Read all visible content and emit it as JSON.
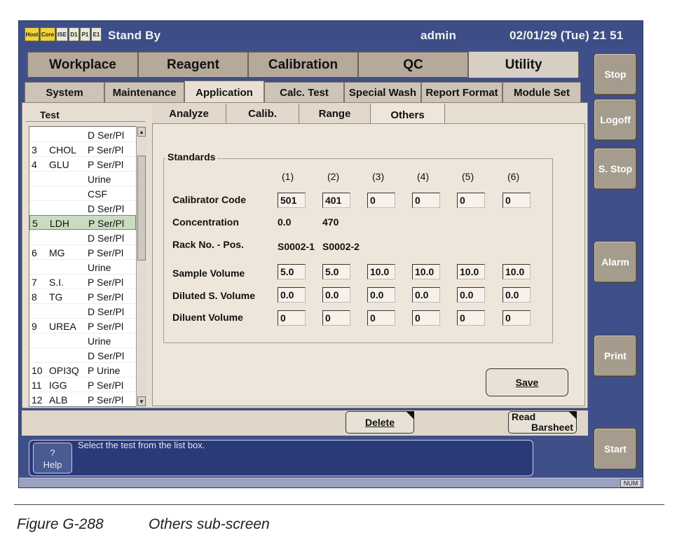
{
  "title_bar": {
    "indicators": [
      "Host",
      "Core",
      "ISE",
      "D1",
      "P1",
      "E1"
    ],
    "status": "Stand By",
    "user": "admin",
    "datetime": "02/01/29 (Tue) 21 51"
  },
  "main_tabs": [
    "Workplace",
    "Reagent",
    "Calibration",
    "QC",
    "Utility"
  ],
  "selected_main_tab": "Utility",
  "sub_tabs": [
    "System",
    "Maintenance",
    "Application",
    "Calc. Test",
    "Special Wash",
    "Report Format",
    "Module Set"
  ],
  "selected_sub_tab": "Application",
  "inner_tabs": [
    "Analyze",
    "Calib.",
    "Range",
    "Others"
  ],
  "selected_inner_tab": "Others",
  "test_list": {
    "header": "Test",
    "items": [
      {
        "num": "",
        "name": "",
        "type": "D Ser/Pl"
      },
      {
        "num": "3",
        "name": "CHOL",
        "type": "P Ser/Pl"
      },
      {
        "num": "4",
        "name": "GLU",
        "type": "P Ser/Pl"
      },
      {
        "num": "",
        "name": "",
        "type": "Urine"
      },
      {
        "num": "",
        "name": "",
        "type": "CSF"
      },
      {
        "num": "",
        "name": "",
        "type": "D Ser/Pl"
      },
      {
        "num": "5",
        "name": "LDH",
        "type": "P Ser/Pl"
      },
      {
        "num": "",
        "name": "",
        "type": "D Ser/Pl"
      },
      {
        "num": "6",
        "name": "MG",
        "type": "P Ser/Pl"
      },
      {
        "num": "",
        "name": "",
        "type": "Urine"
      },
      {
        "num": "7",
        "name": "S.I.",
        "type": "P Ser/Pl"
      },
      {
        "num": "8",
        "name": "TG",
        "type": "P Ser/Pl"
      },
      {
        "num": "",
        "name": "",
        "type": "D Ser/Pl"
      },
      {
        "num": "9",
        "name": "UREA",
        "type": "P Ser/Pl"
      },
      {
        "num": "",
        "name": "",
        "type": "Urine"
      },
      {
        "num": "",
        "name": "",
        "type": "D Ser/Pl"
      },
      {
        "num": "10",
        "name": "OPI3Q",
        "type": "P Urine"
      },
      {
        "num": "11",
        "name": "IGG",
        "type": "P Ser/Pl"
      },
      {
        "num": "12",
        "name": "ALB",
        "type": "P Ser/Pl"
      }
    ],
    "selected_index": 6
  },
  "standards": {
    "group_label": "Standards",
    "columns": [
      "(1)",
      "(2)",
      "(3)",
      "(4)",
      "(5)",
      "(6)"
    ],
    "rows": {
      "calibrator_code": {
        "label": "Calibrator Code",
        "values": [
          "501",
          "401",
          "0",
          "0",
          "0",
          "0"
        ]
      },
      "concentration": {
        "label": "Concentration",
        "values": [
          "0.0",
          "470",
          "",
          "",
          "",
          ""
        ]
      },
      "rack_pos": {
        "label": "Rack No. - Pos.",
        "values": [
          "S0002-1",
          "S0002-2",
          "",
          "",
          "",
          ""
        ]
      },
      "sample_volume": {
        "label": "Sample Volume",
        "values": [
          "5.0",
          "5.0",
          "10.0",
          "10.0",
          "10.0",
          "10.0"
        ]
      },
      "diluted_volume": {
        "label": "Diluted S. Volume",
        "values": [
          "0.0",
          "0.0",
          "0.0",
          "0.0",
          "0.0",
          "0.0"
        ]
      },
      "diluent_volume": {
        "label": "Diluent Volume",
        "values": [
          "0",
          "0",
          "0",
          "0",
          "0",
          "0"
        ]
      }
    }
  },
  "buttons": {
    "save": "Save",
    "delete": "Delete",
    "read_barsheet_line1": "Read",
    "read_barsheet_line2": "Barsheet"
  },
  "side_buttons": [
    "Stop",
    "Logoff",
    "S. Stop",
    "Alarm",
    "Print",
    "Start"
  ],
  "help": {
    "icon": "?",
    "label": "Help"
  },
  "message": "Select the test from the list box.",
  "status_indicator": "NUM",
  "caption": {
    "figure": "Figure G-288",
    "text": "Others sub-screen"
  }
}
